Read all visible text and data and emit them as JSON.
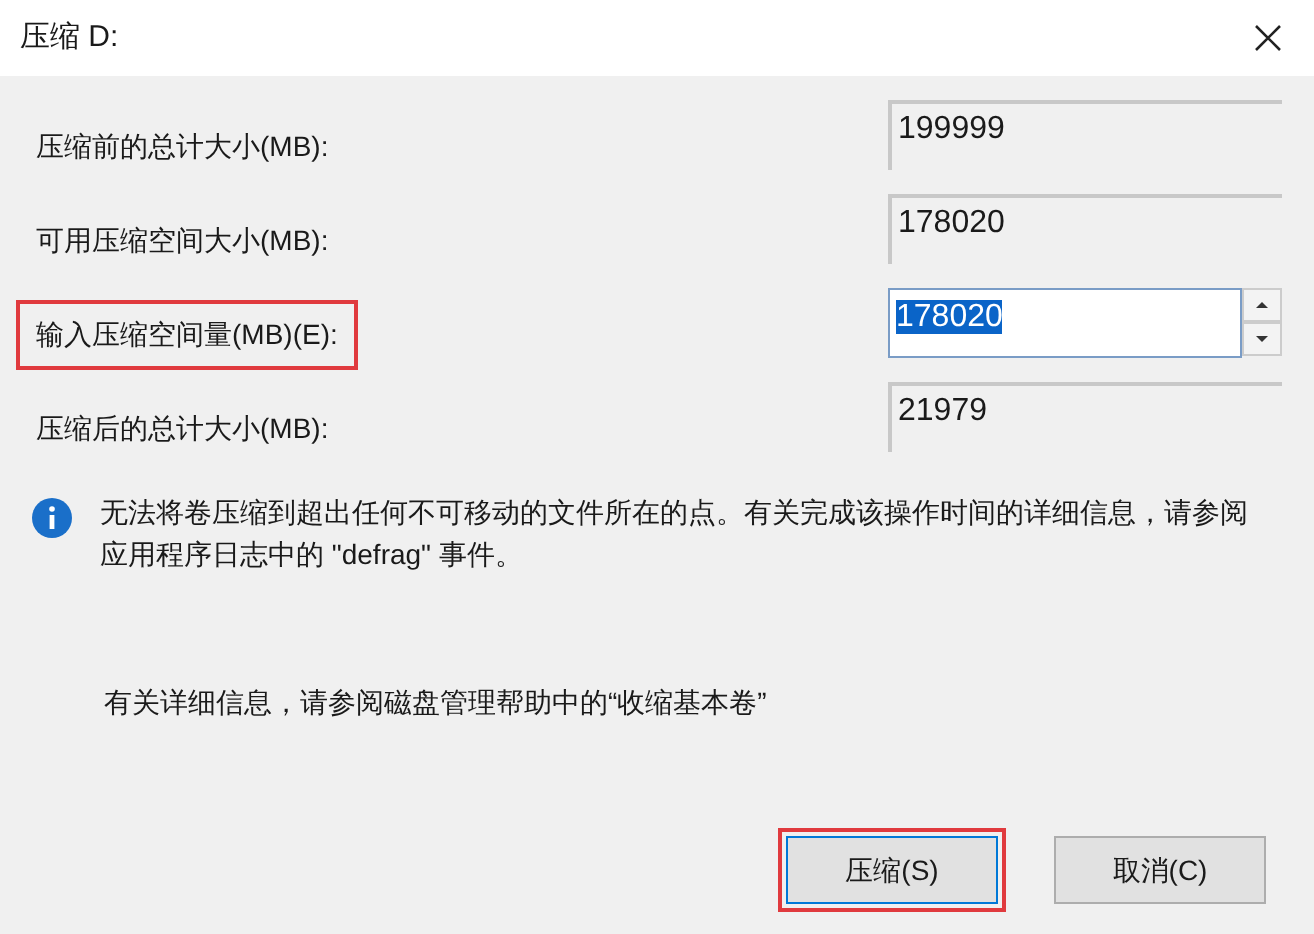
{
  "window": {
    "title": "压缩 D:"
  },
  "rows": [
    {
      "kind": "readonly",
      "label": "压缩前的总计大小(MB):",
      "value": "199999",
      "highlighted": false
    },
    {
      "kind": "readonly",
      "label": "可用压缩空间大小(MB):",
      "value": "178020",
      "highlighted": false
    },
    {
      "kind": "spinner",
      "label": "输入压缩空间量(MB)(E):",
      "value": "178020",
      "text_selected": true,
      "highlighted": true
    },
    {
      "kind": "readonly",
      "label": "压缩后的总计大小(MB):",
      "value": "21979",
      "highlighted": false
    }
  ],
  "info": {
    "text": "无法将卷压缩到超出任何不可移动的文件所在的点。有关完成该操作时间的详细信息，请参阅应用程序日志中的 \"defrag\" 事件。"
  },
  "help_text": "有关详细信息，请参阅磁盘管理帮助中的“收缩基本卷”",
  "buttons": [
    {
      "label": "压缩(S)",
      "default": true,
      "highlighted": true
    },
    {
      "label": "取消(C)",
      "default": false,
      "highlighted": false
    }
  ]
}
